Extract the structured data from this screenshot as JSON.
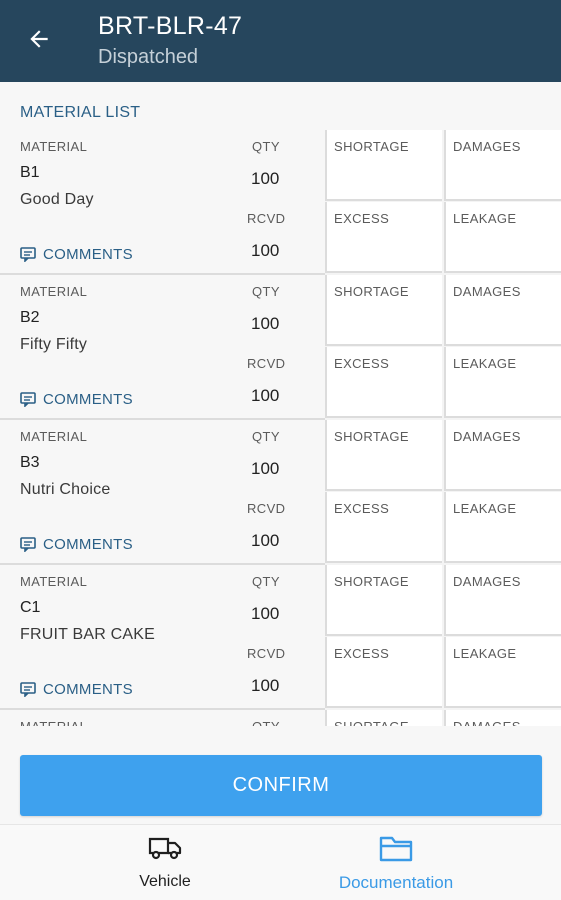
{
  "header": {
    "title": "BRT-BLR-47",
    "subtitle": "Dispatched",
    "back_icon": "arrow-left-icon"
  },
  "section": {
    "title": "MATERIAL LIST"
  },
  "labels": {
    "material": "MATERIAL",
    "qty": "QTY",
    "rcvd": "RCVD",
    "comments": "COMMENTS",
    "shortage": "SHORTAGE",
    "damages": "DAMAGES",
    "excess": "EXCESS",
    "leakage": "LEAKAGE"
  },
  "materials": [
    {
      "code": "B1",
      "name": "Good Day",
      "qty": "100",
      "rcvd": "100"
    },
    {
      "code": "B2",
      "name": "Fifty Fifty",
      "qty": "100",
      "rcvd": "100"
    },
    {
      "code": "B3",
      "name": "Nutri Choice",
      "qty": "100",
      "rcvd": "100"
    },
    {
      "code": "C1",
      "name": "FRUIT BAR CAKE",
      "qty": "100",
      "rcvd": "100"
    },
    {
      "code": "",
      "name": "",
      "qty": "",
      "rcvd": ""
    }
  ],
  "actions": {
    "confirm_label": "CONFIRM"
  },
  "bottom_nav": {
    "items": [
      {
        "label": "Vehicle",
        "icon": "truck-icon",
        "active": false
      },
      {
        "label": "Documentation",
        "icon": "folder-icon",
        "active": true
      }
    ]
  },
  "colors": {
    "app_bar": "#26465d",
    "accent": "#3ea1ee",
    "link": "#2a5f86",
    "active_nav": "#3a9ae6"
  }
}
